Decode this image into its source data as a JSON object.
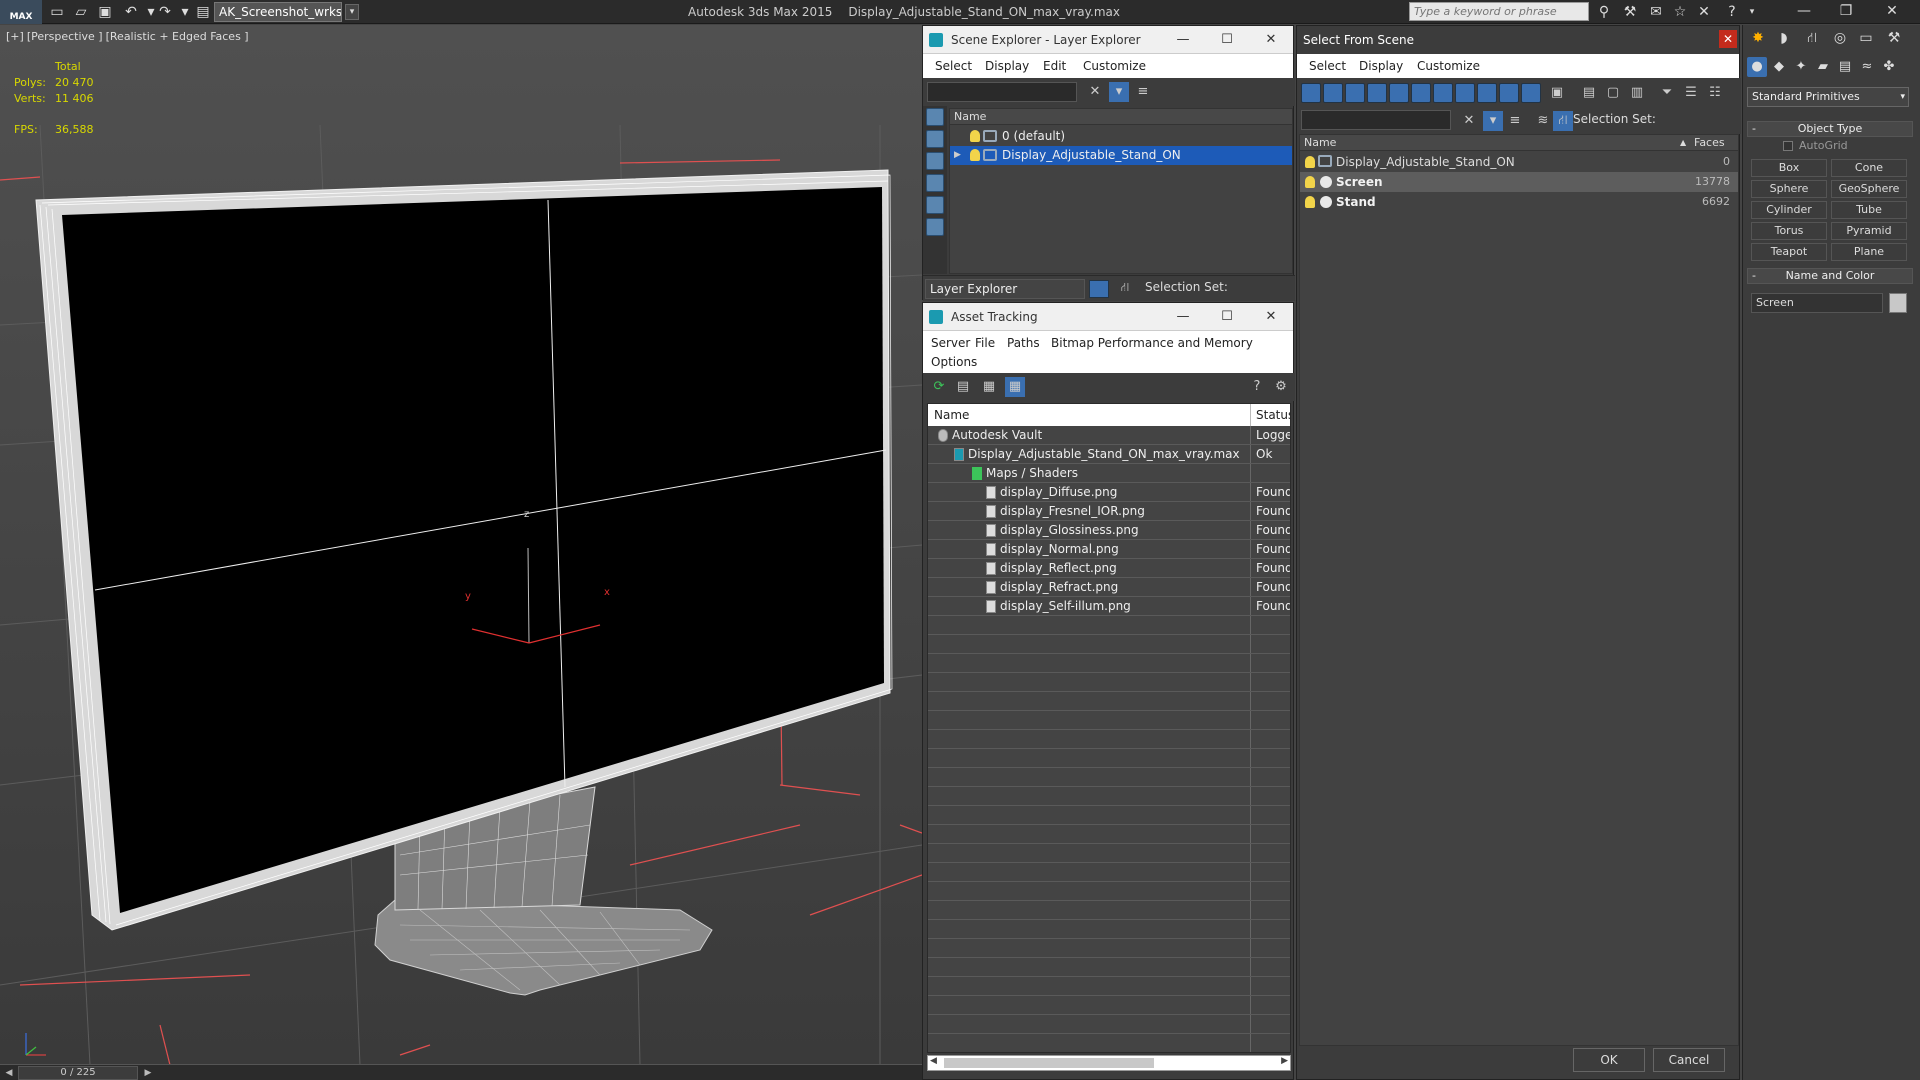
{
  "app": {
    "logo": "MAX",
    "workspace": "AK_Screenshot_wrksp",
    "title": "Autodesk 3ds Max  2015",
    "file": "Display_Adjustable_Stand_ON_max_vray.max",
    "search_placeholder": "Type a keyword or phrase"
  },
  "viewport": {
    "label_parts": [
      "[+]",
      "[Perspective ]",
      "[Realistic + Edged Faces ]"
    ],
    "stats": {
      "total_label": "Total",
      "polys_label": "Polys:",
      "polys_value": "20 470",
      "verts_label": "Verts:",
      "verts_value": "11 406",
      "fps_label": "FPS:",
      "fps_value": "36,588"
    },
    "axis": {
      "x": "x",
      "y": "y",
      "z": "z"
    },
    "time_slider": "0 / 225"
  },
  "scene_explorer": {
    "title": "Scene Explorer - Layer Explorer",
    "menu": [
      "Select",
      "Display",
      "Edit",
      "Customize"
    ],
    "column": "Name",
    "rows": [
      {
        "label": "0 (default)",
        "selected": false
      },
      {
        "label": "Display_Adjustable_Stand_ON",
        "selected": true
      }
    ],
    "footer_dropdown": "Layer Explorer",
    "selection_set_label": "Selection Set:"
  },
  "asset_tracking": {
    "title": "Asset Tracking",
    "menu": [
      "Server",
      "File",
      "Paths",
      "Bitmap Performance and Memory",
      "Options"
    ],
    "columns": {
      "name": "Name",
      "status": "Status"
    },
    "rows": [
      {
        "name": "Autodesk Vault",
        "status": "Logged",
        "indent": 0
      },
      {
        "name": "Display_Adjustable_Stand_ON_max_vray.max",
        "status": "Ok",
        "indent": 1
      },
      {
        "name": "Maps / Shaders",
        "status": "",
        "indent": 2
      },
      {
        "name": "display_Diffuse.png",
        "status": "Found",
        "indent": 3
      },
      {
        "name": "display_Fresnel_IOR.png",
        "status": "Found",
        "indent": 3
      },
      {
        "name": "display_Glossiness.png",
        "status": "Found",
        "indent": 3
      },
      {
        "name": "display_Normal.png",
        "status": "Found",
        "indent": 3
      },
      {
        "name": "display_Reflect.png",
        "status": "Found",
        "indent": 3
      },
      {
        "name": "display_Refract.png",
        "status": "Found",
        "indent": 3
      },
      {
        "name": "display_Self-illum.png",
        "status": "Found",
        "indent": 3
      }
    ]
  },
  "select_from_scene": {
    "title": "Select From Scene",
    "menu": [
      "Select",
      "Display",
      "Customize"
    ],
    "selection_set_label": "Selection Set:",
    "columns": {
      "name": "Name",
      "faces": "Faces"
    },
    "rows": [
      {
        "name": "Display_Adjustable_Stand_ON",
        "faces": "0",
        "selected": false,
        "bold": false
      },
      {
        "name": "Screen",
        "faces": "13778",
        "selected": true,
        "bold": true
      },
      {
        "name": "Stand",
        "faces": "6692",
        "selected": false,
        "bold": true
      }
    ],
    "ok": "OK",
    "cancel": "Cancel"
  },
  "command_panel": {
    "category": "Standard Primitives",
    "object_type_label": "Object Type",
    "autogrid_label": "AutoGrid",
    "primitives": [
      "Box",
      "Cone",
      "Sphere",
      "GeoSphere",
      "Cylinder",
      "Tube",
      "Torus",
      "Pyramid",
      "Teapot",
      "Plane"
    ],
    "name_color_label": "Name and Color",
    "object_name": "Screen"
  },
  "colors": {
    "selection_blue": "#1d5bb8",
    "stats_yellow": "#d8d800",
    "grid_red": "#e05050"
  }
}
